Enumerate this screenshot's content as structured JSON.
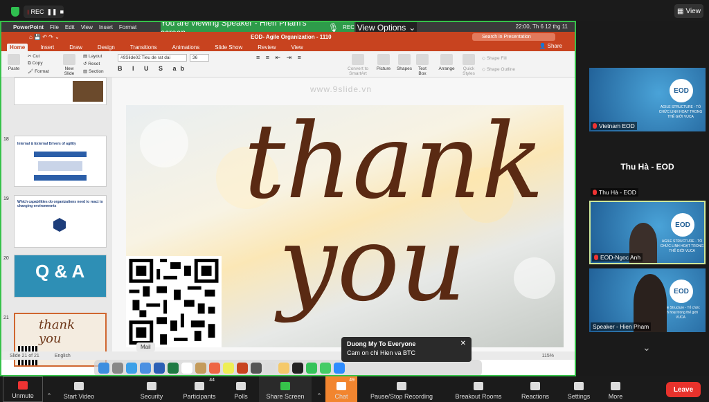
{
  "zoom_top": {
    "rec": "REC",
    "view_button": "View"
  },
  "banner": {
    "viewing": "You are viewing Speaker - Hien Pham's screen",
    "rec": "REC",
    "view_options": "View Options"
  },
  "mac": {
    "app": "PowerPoint",
    "menus": [
      "File",
      "Edit",
      "View",
      "Insert",
      "Format"
    ],
    "clock": "22:00, Th 6 12 thg 11"
  },
  "ppt": {
    "doc_title": "EOD- Agile Organization - 1110",
    "search_placeholder": "Search in Presentation",
    "share": "Share",
    "tabs": [
      "Home",
      "Insert",
      "Draw",
      "Design",
      "Transitions",
      "Animations",
      "Slide Show",
      "Review",
      "View"
    ],
    "ribbon": {
      "paste": "Paste",
      "cut": "Cut",
      "copy": "Copy",
      "format": "Format",
      "new_slide": "New Slide",
      "layout": "Layout",
      "reset": "Reset",
      "section": "Section",
      "font": "#9Slide02 Tieu de rat dai",
      "size": "36",
      "convert": "Convert to SmartArt",
      "picture": "Picture",
      "shapes": "Shapes",
      "textbox": "Text Box",
      "arrange": "Arrange",
      "quick_styles": "Quick Styles",
      "shape_fill": "Shape Fill",
      "shape_outline": "Shape Outline"
    },
    "thumb_numbers": [
      "18",
      "19",
      "20",
      "21"
    ],
    "thumb_texts": {
      "t18_title": "Internal & External Drivers of agility",
      "t19_title": "Which capabilities do organizations need to react to changing environments",
      "t20": "Q & A",
      "t21": "thank you"
    },
    "watermark": "www.9slide.vn",
    "slide": {
      "line1": "thank",
      "line2": "you"
    },
    "status_slide": "Slide 21 of 21",
    "status_lang": "English",
    "zoom": "115%"
  },
  "dock": {
    "tooltip": "Mail"
  },
  "chat_popup": {
    "sender": "Duong My To Everyone",
    "message": "Cam on chi Hien va BTC"
  },
  "gallery": [
    {
      "name": "Vietnam EOD",
      "logo": "EOD",
      "caption": "AGILE STRUCTURE - TỔ CHỨC LINH HOẠT TRONG THẾ GIỚI VUCA"
    },
    {
      "name": "Thu Hà - EOD",
      "big": "Thu Hà - EOD"
    },
    {
      "name": "EOD-Ngoc Anh",
      "logo": "EOD",
      "caption": "AGILE STRUCTURE - TỔ CHỨC LINH HOẠT TRONG THẾ GIỚI VUCA"
    },
    {
      "name": "Speaker - Hien Pham",
      "logo": "EOD",
      "caption": "Agile Structure - Tổ chức linh hoạt trong thế giới VUCA"
    }
  ],
  "toolbar": {
    "unmute": "Unmute",
    "start_video": "Start Video",
    "security": "Security",
    "participants": "Participants",
    "participants_count": "44",
    "polls": "Polls",
    "share_screen": "Share Screen",
    "chat": "Chat",
    "chat_count": "49",
    "recording": "Pause/Stop Recording",
    "breakout": "Breakout Rooms",
    "reactions": "Reactions",
    "settings": "Settings",
    "more": "More",
    "leave": "Leave"
  },
  "colors": {
    "accent_green": "#36c24a",
    "ppt_orange": "#c8431f",
    "leave_red": "#e8322c",
    "chat_orange": "#f2852f"
  }
}
